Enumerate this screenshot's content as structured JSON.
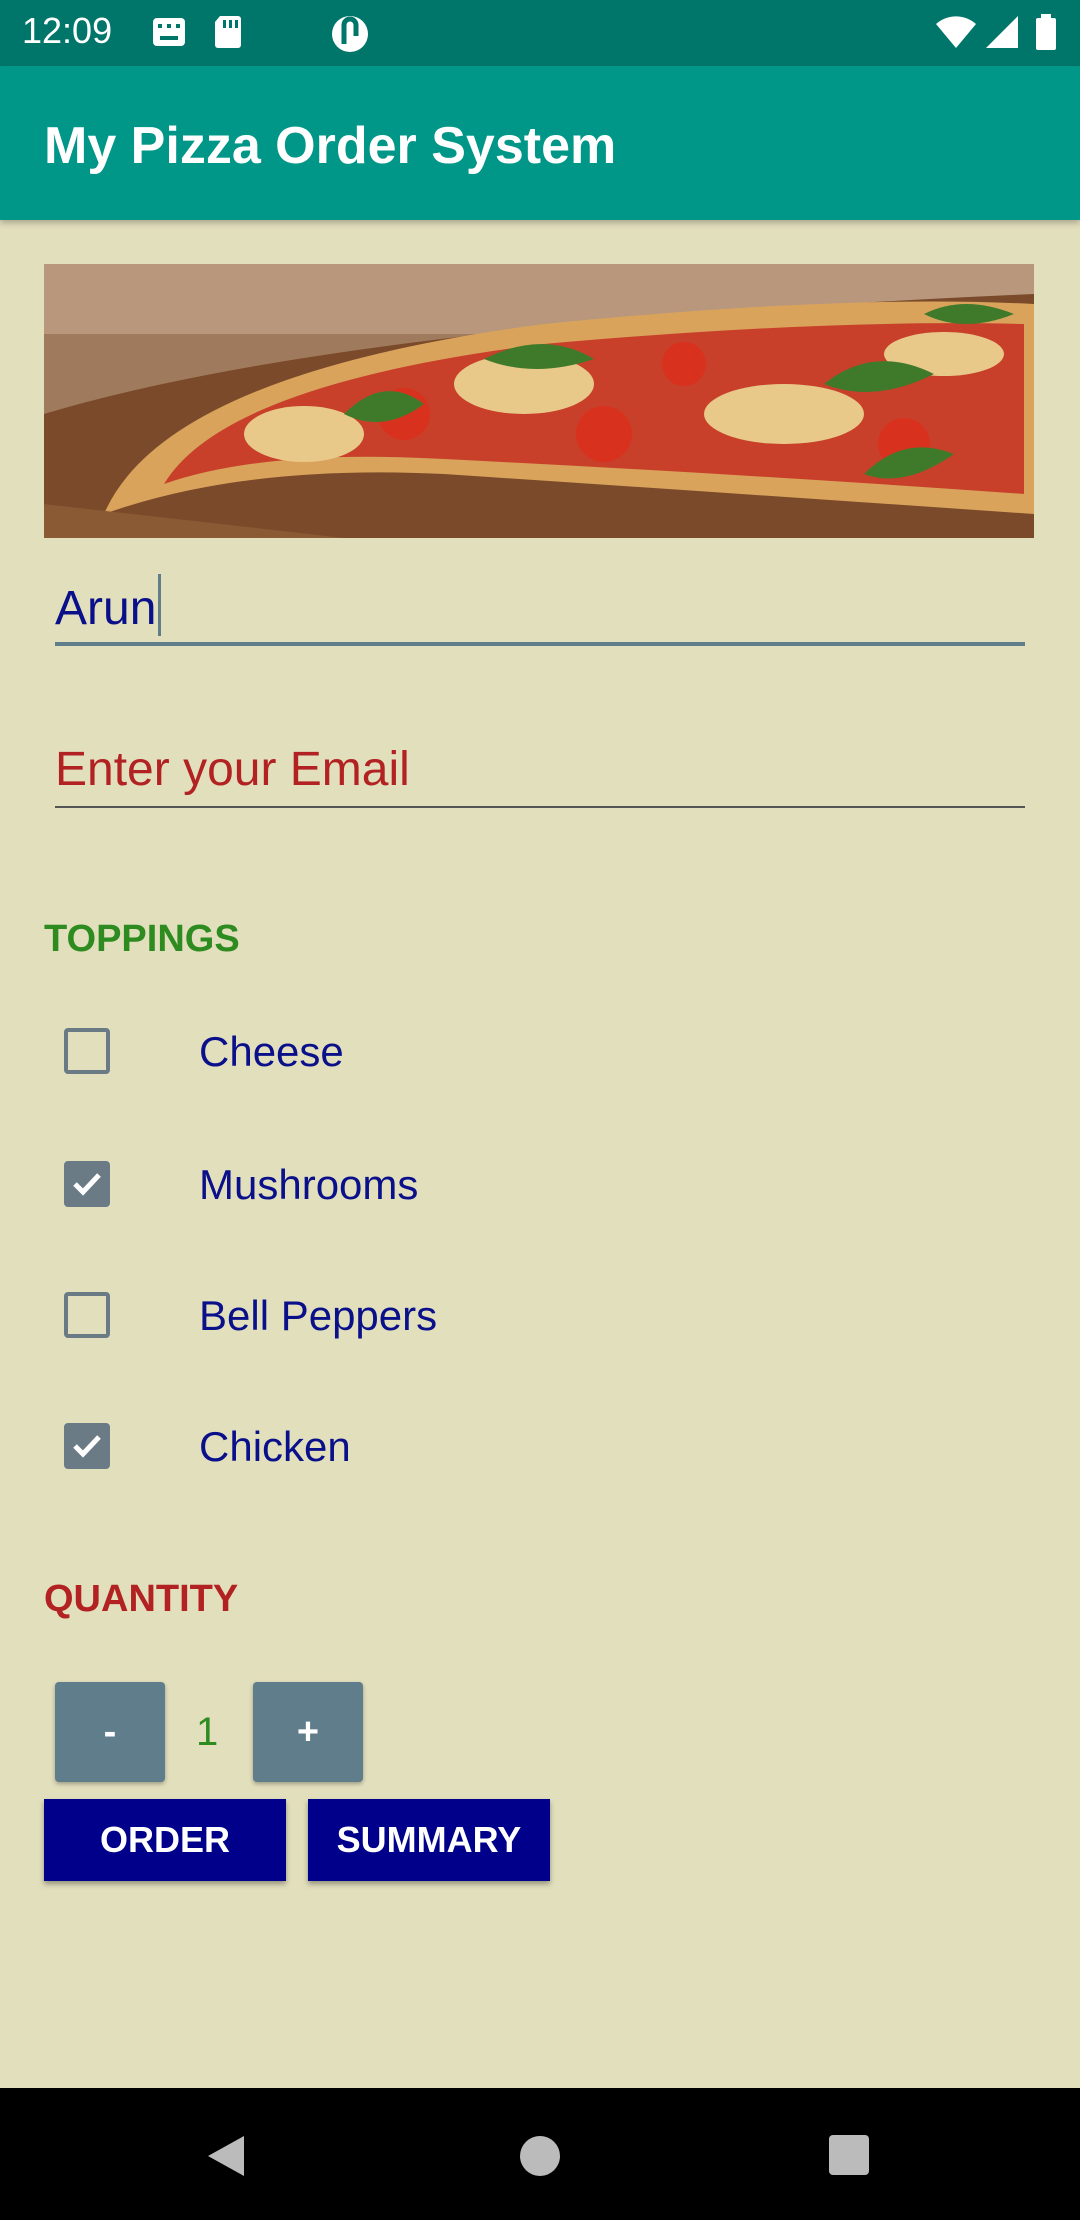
{
  "status_bar": {
    "time": "12:09"
  },
  "app_bar": {
    "title": "My Pizza Order System"
  },
  "hero": {
    "description": "pizza"
  },
  "form": {
    "name_value": "Arun",
    "email_placeholder": "Enter your Email"
  },
  "toppings": {
    "label": "TOPPINGS",
    "items": [
      {
        "label": "Cheese",
        "checked": false
      },
      {
        "label": "Mushrooms",
        "checked": true
      },
      {
        "label": "Bell Peppers",
        "checked": false
      },
      {
        "label": "Chicken",
        "checked": true
      }
    ]
  },
  "quantity": {
    "label": "QUANTITY",
    "minus_label": "-",
    "value": "1",
    "plus_label": "+"
  },
  "actions": {
    "order_label": "ORDER",
    "summary_label": "SUMMARY"
  },
  "colors": {
    "app_bar": "#009688",
    "status_bar": "#00766a",
    "background": "#e2dfbd",
    "button": "#00008b"
  }
}
